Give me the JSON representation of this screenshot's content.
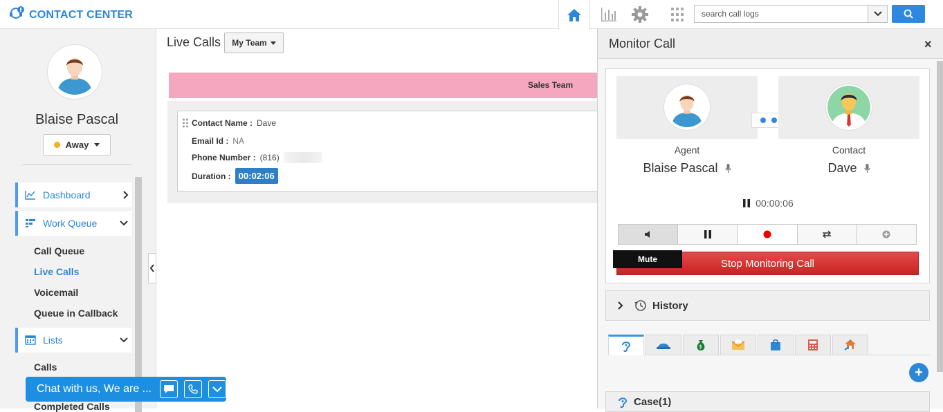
{
  "app": {
    "title": "CONTACT CENTER"
  },
  "header": {
    "search_placeholder": "search call logs"
  },
  "sidebar": {
    "user_name": "Blaise Pascal",
    "status": "Away",
    "nav": [
      {
        "label": "Dashboard"
      },
      {
        "label": "Work Queue"
      },
      {
        "label": "Lists"
      }
    ],
    "work_queue_items": [
      "Call Queue",
      "Live Calls",
      "Voicemail",
      "Queue in Callback"
    ],
    "lists_items": [
      "Calls",
      "Completed Calls"
    ]
  },
  "chat": {
    "text": "Chat with us, We are ..."
  },
  "main": {
    "title": "Live Calls",
    "team_filter": "My Team",
    "team_bar": "Sales Team",
    "call": {
      "contact_name_label": "Contact Name :",
      "contact_name": "Dave",
      "email_label": "Email Id :",
      "email": "NA",
      "phone_label": "Phone Number :",
      "phone": "(816)",
      "duration_label": "Duration :",
      "duration": "00:02:06"
    }
  },
  "monitor": {
    "title": "Monitor Call",
    "close": "×",
    "agent_role": "Agent",
    "agent_name": "Blaise Pascal",
    "contact_role": "Contact",
    "contact_name": "Dave",
    "timer": "00:00:06",
    "stop_label": "Stop Monitoring Call",
    "tooltip": "Mute",
    "history_label": "History",
    "case_label": "Case(1)",
    "add_label": "+"
  },
  "colors": {
    "brand": "#2c87d6",
    "team_bar": "#f6a7c0",
    "stop": "#d32f2f",
    "status_away": "#f5b21a"
  }
}
